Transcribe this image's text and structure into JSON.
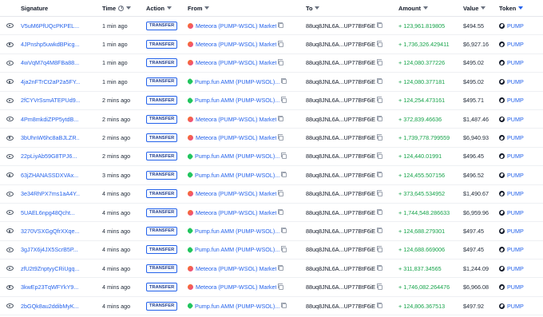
{
  "columns": {
    "signature": "Signature",
    "time": "Time",
    "action": "Action",
    "from": "From",
    "to": "To",
    "amount": "Amount",
    "value": "Value",
    "token": "Token"
  },
  "rows": [
    {
      "signature": "V5uM6PfUQcPKPEL...",
      "time": "1 min ago",
      "action": "TRANSFER",
      "from": "Meteora (PUMP-WSOL) Market",
      "from_source": "meteora",
      "to": "88uq8JNL6A...UP77BtF6iE",
      "amount": "+ 123,961.819805",
      "value": "$494.55",
      "token": "PUMP"
    },
    {
      "signature": "4JPnshp5uwkdBPicg...",
      "time": "1 min ago",
      "action": "TRANSFER",
      "from": "Meteora (PUMP-WSOL) Market",
      "from_source": "meteora",
      "to": "88uq8JNL6A...UP77BtF6iE",
      "amount": "+ 1,736,326.429411",
      "value": "$6,927.16",
      "token": "PUMP"
    },
    {
      "signature": "4wVqM7q4M8FBa88...",
      "time": "1 min ago",
      "action": "TRANSFER",
      "from": "Meteora (PUMP-WSOL) Market",
      "from_source": "meteora",
      "to": "88uq8JNL6A...UP77BtF6iE",
      "amount": "+ 124,080.377226",
      "value": "$495.02",
      "token": "PUMP"
    },
    {
      "signature": "4ja2nFTrCt2aP2a5FY...",
      "time": "1 min ago",
      "action": "TRANSFER",
      "from": "Pump.fun AMM (PUMP-WSOL)...",
      "from_source": "pumpfun",
      "to": "88uq8JNL6A...UP77BtF6iE",
      "amount": "+ 124,080.377181",
      "value": "$495.02",
      "token": "PUMP"
    },
    {
      "signature": "2fCYVrSsmATEPUd9...",
      "time": "2 mins ago",
      "action": "TRANSFER",
      "from": "Pump.fun AMM (PUMP-WSOL)...",
      "from_source": "pumpfun",
      "to": "88uq8JNL6A...UP77BtF6iE",
      "amount": "+ 124,254.473161",
      "value": "$495.71",
      "token": "PUMP"
    },
    {
      "signature": "4Pm8mkdiZPP5ytdB...",
      "time": "2 mins ago",
      "action": "TRANSFER",
      "from": "Meteora (PUMP-WSOL) Market",
      "from_source": "meteora",
      "to": "88uq8JNL6A...UP77BtF6iE",
      "amount": "+ 372,839.46636",
      "value": "$1,487.46",
      "token": "PUMP"
    },
    {
      "signature": "3bUhnW6hc8aBJLZR...",
      "time": "2 mins ago",
      "action": "TRANSFER",
      "from": "Meteora (PUMP-WSOL) Market",
      "from_source": "meteora",
      "to": "88uq8JNL6A...UP77BtF6iE",
      "amount": "+ 1,739,778.799559",
      "value": "$6,940.93",
      "token": "PUMP"
    },
    {
      "signature": "22pLiyAb59G8TPJ6...",
      "time": "2 mins ago",
      "action": "TRANSFER",
      "from": "Pump.fun AMM (PUMP-WSOL)...",
      "from_source": "pumpfun",
      "to": "88uq8JNL6A...UP77BtF6iE",
      "amount": "+ 124,440.01991",
      "value": "$496.45",
      "token": "PUMP"
    },
    {
      "signature": "63jZHANASSDXVAx...",
      "time": "3 mins ago",
      "action": "TRANSFER",
      "from": "Pump.fun AMM (PUMP-WSOL)...",
      "from_source": "pumpfun",
      "to": "88uq8JNL6A...UP77BtF6iE",
      "amount": "+ 124,455.507156",
      "value": "$496.52",
      "token": "PUMP"
    },
    {
      "signature": "3e34RhPX7ms1aA4Y...",
      "time": "4 mins ago",
      "action": "TRANSFER",
      "from": "Meteora (PUMP-WSOL) Market",
      "from_source": "meteora",
      "to": "88uq8JNL6A...UP77BtF6iE",
      "amount": "+ 373,645.534952",
      "value": "$1,490.67",
      "token": "PUMP"
    },
    {
      "signature": "5UAEL6npg48Qcht...",
      "time": "4 mins ago",
      "action": "TRANSFER",
      "from": "Meteora (PUMP-WSOL) Market",
      "from_source": "meteora",
      "to": "88uq8JNL6A...UP77BtF6iE",
      "amount": "+ 1,744,548.286633",
      "value": "$6,959.96",
      "token": "PUMP"
    },
    {
      "signature": "3270VSXGgQfrXXqe...",
      "time": "4 mins ago",
      "action": "TRANSFER",
      "from": "Pump.fun AMM (PUMP-WSOL)...",
      "from_source": "pumpfun",
      "to": "88uq8JNL6A...UP77BtF6iE",
      "amount": "+ 124,688.279301",
      "value": "$497.45",
      "token": "PUMP"
    },
    {
      "signature": "3gJ7X6j4JX5ScrB5P...",
      "time": "4 mins ago",
      "action": "TRANSFER",
      "from": "Pump.fun AMM (PUMP-WSOL)...",
      "from_source": "pumpfun",
      "to": "88uq8JNL6A...UP77BtF6iE",
      "amount": "+ 124,688.669006",
      "value": "$497.45",
      "token": "PUMP"
    },
    {
      "signature": "zfU2t9ZnptyyCRiUgq...",
      "time": "4 mins ago",
      "action": "TRANSFER",
      "from": "Meteora (PUMP-WSOL) Market",
      "from_source": "meteora",
      "to": "88uq8JNL6A...UP77BtF6iE",
      "amount": "+ 311,837.34565",
      "value": "$1,244.09",
      "token": "PUMP"
    },
    {
      "signature": "3kwEp23TqWFYkY9...",
      "time": "4 mins ago",
      "action": "TRANSFER",
      "from": "Meteora (PUMP-WSOL) Market",
      "from_source": "meteora",
      "to": "88uq8JNL6A...UP77BtF6iE",
      "amount": "+ 1,746,082.264476",
      "value": "$6,966.08",
      "token": "PUMP"
    },
    {
      "signature": "2bGQk8au2ddibMyK...",
      "time": "4 mins ago",
      "action": "TRANSFER",
      "from": "Pump.fun AMM (PUMP-WSOL)...",
      "from_source": "pumpfun",
      "to": "88uq8JNL6A...UP77BtF6iE",
      "amount": "+ 124,806.367513",
      "value": "$497.92",
      "token": "PUMP"
    }
  ]
}
